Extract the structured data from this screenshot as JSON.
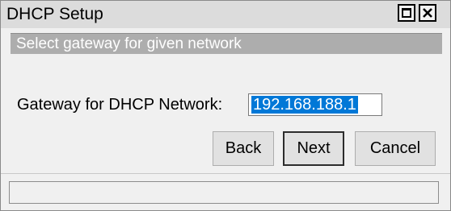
{
  "window": {
    "title": "DHCP Setup",
    "controls": {
      "maximize_icon": "maximize-icon",
      "close_icon": "close-icon"
    }
  },
  "subtitle": "Select gateway for given network",
  "gateway_field": {
    "label": "Gateway for DHCP Network:",
    "value": "192.168.188.1",
    "selected": true
  },
  "buttons": {
    "back": "Back",
    "next": "Next",
    "cancel": "Cancel"
  },
  "status_bar": {
    "text": ""
  },
  "colors": {
    "selection": "#0078d7",
    "subtitle_bg": "#adadad",
    "titlebar_bg": "#dcdcdc"
  }
}
